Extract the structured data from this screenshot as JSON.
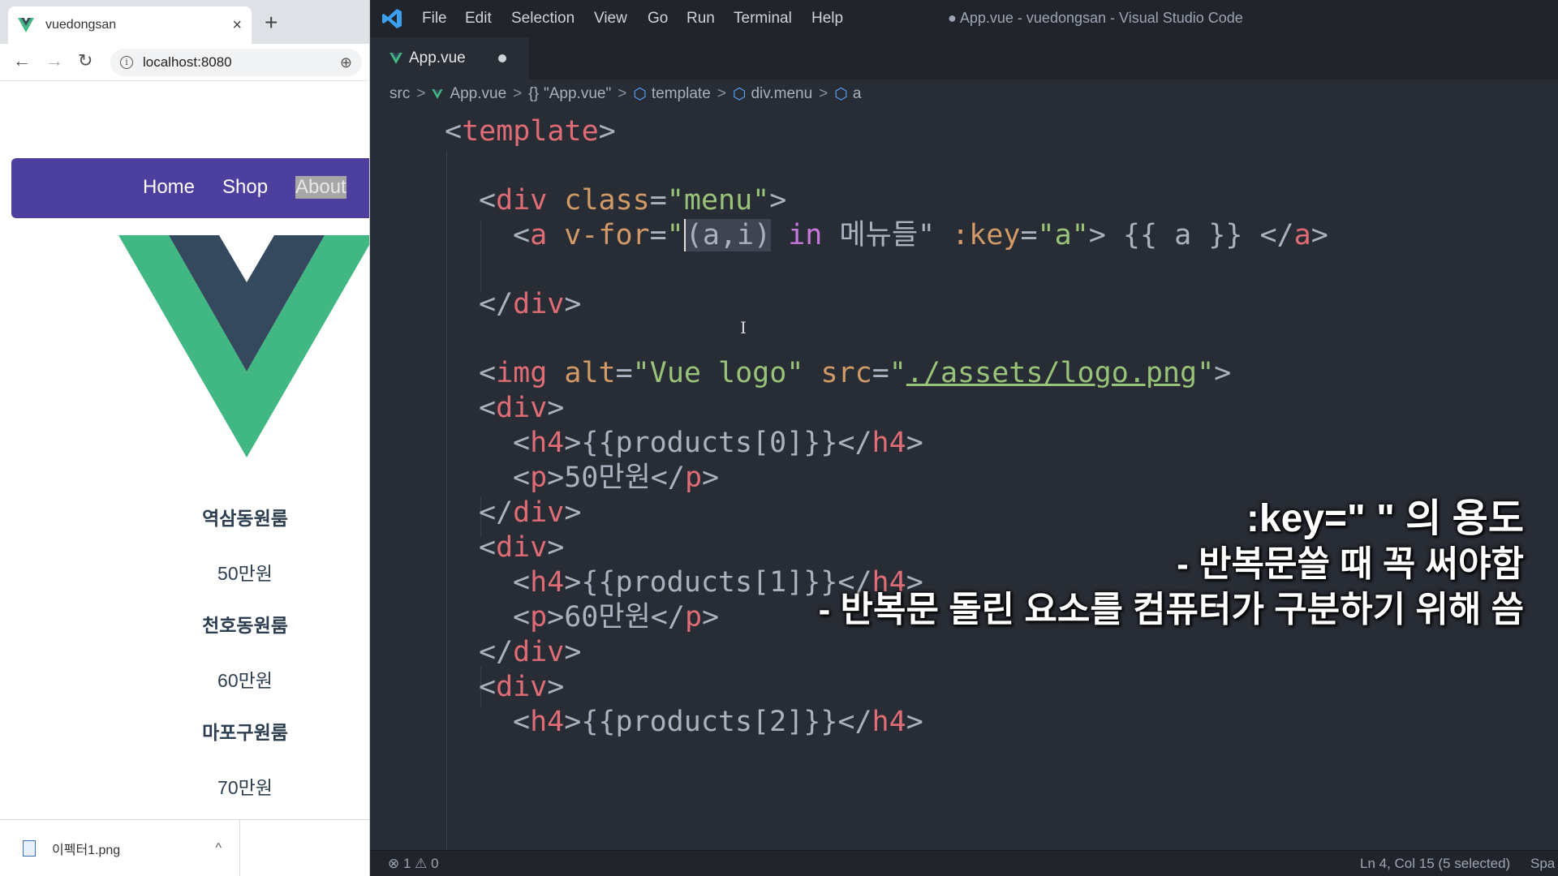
{
  "browser": {
    "tab_title": "vuedongsan",
    "tab_close": "×",
    "new_tab": "+",
    "url": "localhost:8080",
    "nav": {
      "back": "←",
      "forward": "→",
      "reload": "↻",
      "info": "i",
      "zoom": "⊕"
    },
    "menu": [
      {
        "label": "Home"
      },
      {
        "label": "Shop"
      },
      {
        "label": "About",
        "selected": true
      }
    ],
    "products": [
      {
        "name": "역삼동원룸",
        "price": "50만원"
      },
      {
        "name": "천호동원룸",
        "price": "60만원"
      },
      {
        "name": "마포구원룸",
        "price": "70만원"
      }
    ],
    "download": {
      "filename": "이펙터1.png",
      "chevron": "^"
    },
    "colors": {
      "menu_bg": "#4d3f9e",
      "vue_green": "#41b883",
      "vue_dark": "#34495e"
    }
  },
  "vscode": {
    "menu": [
      "File",
      "Edit",
      "Selection",
      "View",
      "Go",
      "Run",
      "Terminal",
      "Help"
    ],
    "window_title": "● App.vue - vuedongsan - Visual Studio Code",
    "tab": {
      "name": "App.vue",
      "modified": true
    },
    "breadcrumb": {
      "src": "src",
      "file": "App.vue",
      "braces": "{}",
      "script": "\"App.vue\"",
      "template": "template",
      "divmenu": "div.menu",
      "a": "a",
      "sep": ">"
    },
    "code": {
      "l1": {
        "open": "<",
        "tag": "template",
        "close": ">"
      },
      "l3": {
        "open": "<",
        "tag": "div",
        "attr": "class",
        "eq": "=",
        "val": "\"menu\"",
        "close": ">"
      },
      "l4": {
        "open": "<",
        "tag": "a",
        "attr": "v-for",
        "eq": "=",
        "q1": "\"",
        "sel": "(a,i)",
        "sp1": " ",
        "kw": "in",
        "rest": " 메뉴들\"",
        "attr2": " :key",
        "eq2": "=",
        "val2": "\"a\"",
        "close": ">",
        "interp": " {{ a }} ",
        "endopen": "</",
        "endtag": "a",
        "endclose": ">"
      },
      "l6": {
        "open": "</",
        "tag": "div",
        "close": ">"
      },
      "l8": {
        "open": "<",
        "tag": "img",
        "attr": " alt",
        "eq": "=",
        "val": "\"Vue logo\"",
        "attr2": " src",
        "eq2": "=",
        "q1": "\"",
        "path": "./assets/logo.png",
        "q2": "\"",
        "close": ">"
      },
      "l9": {
        "open": "<",
        "tag": "div",
        "close": ">"
      },
      "l10": {
        "open": "<",
        "tag": "h4",
        "close": ">",
        "text": "{{products[0]}}",
        "endopen": "</",
        "endtag": "h4",
        "endclose": ">"
      },
      "l11": {
        "open": "<",
        "tag": "p",
        "close": ">",
        "text": "50만원",
        "endopen": "</",
        "endtag": "p",
        "endclose": ">"
      },
      "l12": {
        "open": "</",
        "tag": "div",
        "close": ">"
      },
      "l13": {
        "open": "<",
        "tag": "div",
        "close": ">"
      },
      "l14": {
        "open": "<",
        "tag": "h4",
        "close": ">",
        "text": "{{products[1]}}",
        "endopen": "</",
        "endtag": "h4",
        "endclose": ">"
      },
      "l15": {
        "open": "<",
        "tag": "p",
        "close": ">",
        "text": "60만원",
        "endopen": "</",
        "endtag": "p",
        "endclose": ">"
      },
      "l16": {
        "open": "</",
        "tag": "div",
        "close": ">"
      },
      "l17": {
        "open": "<",
        "tag": "div",
        "close": ">"
      },
      "l18": {
        "open": "<",
        "tag": "h4",
        "close": ">",
        "text": "{{products[2]}}",
        "endopen": "</",
        "endtag": "h4",
        "endclose": ">"
      }
    },
    "overlay": {
      "line1": ":key=\" \" 의 용도",
      "line2": "- 반복문쓸 때 꼭 써야함",
      "line3": "- 반복문 돌린 요소를 컴퓨터가 구분하기 위해 씀"
    },
    "status": {
      "problems": "⊗ 1 ⚠ 0",
      "position": "Ln 4, Col 15 (5 selected)",
      "spaces": "Spa"
    },
    "colors": {
      "editor_bg": "#282c34",
      "tag": "#e06c75",
      "attr": "#d19a66",
      "string": "#98c379",
      "keyword": "#c678dd"
    }
  }
}
